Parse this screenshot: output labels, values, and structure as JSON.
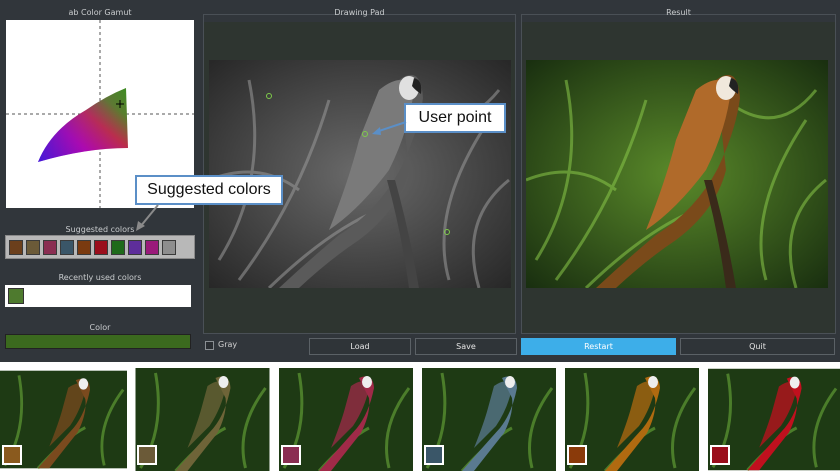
{
  "gamut": {
    "title": "ab Color Gamut"
  },
  "drawing_pad": {
    "title": "Drawing Pad"
  },
  "result": {
    "title": "Result"
  },
  "suggested": {
    "title": "Suggested colors",
    "swatches": [
      "#6b3f1c",
      "#6b5a38",
      "#8a2e52",
      "#3a5668",
      "#7a3a10",
      "#9a0e1c",
      "#1e6a1a",
      "#5e2e9a",
      "#9a1a7a",
      "#8e8e8e"
    ]
  },
  "recent": {
    "title": "Recently used colors",
    "swatches": [
      "#4e7a2e"
    ]
  },
  "color": {
    "title": "Color",
    "value": "#3b6a1e"
  },
  "controls": {
    "gray_label": "Gray",
    "load": "Load",
    "save": "Save",
    "restart": "Restart",
    "quit": "Quit"
  },
  "callouts": {
    "user_point": "User point",
    "suggested_colors": "Suggested colors"
  },
  "thumbnails": [
    {
      "tint": "#7a4a1e",
      "chip": "#8a5a1e"
    },
    {
      "tint": "#6e6438",
      "chip": "#6b5a38"
    },
    {
      "tint": "#a02a48",
      "chip": "#8a2e52"
    },
    {
      "tint": "#5a7a90",
      "chip": "#3a5668"
    },
    {
      "tint": "#b06a10",
      "chip": "#8a3a0a"
    },
    {
      "tint": "#c0101e",
      "chip": "#9a0e1c"
    }
  ]
}
